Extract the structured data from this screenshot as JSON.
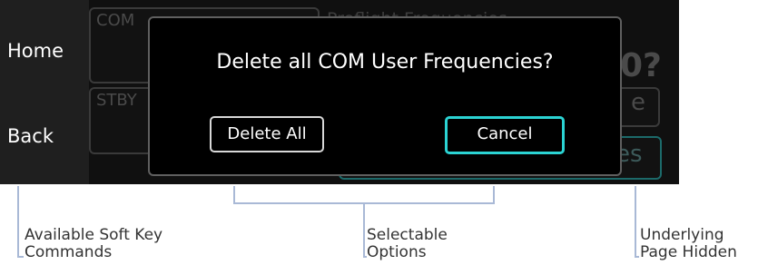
{
  "softkeys": {
    "home": "Home",
    "back": "Back"
  },
  "underlying": {
    "com_label": "COM",
    "stby_label": "STBY",
    "title_fragment": "Preflight Frequencies",
    "big_fragment": "0?",
    "button_fragment_1": "e",
    "button_fragment_2": "es"
  },
  "dialog": {
    "message": "Delete all COM User Frequencies?",
    "delete_label": "Delete All",
    "cancel_label": "Cancel"
  },
  "callouts": {
    "soft_line1": "Available Soft Key",
    "soft_line2": "Commands",
    "sel_line1": "Selectable",
    "sel_line2": "Options",
    "under_line1": "Underlying",
    "under_line2": "Page Hidden"
  },
  "colors": {
    "accent": "#2bd3d3",
    "callout_line": "#a9b9d6"
  }
}
